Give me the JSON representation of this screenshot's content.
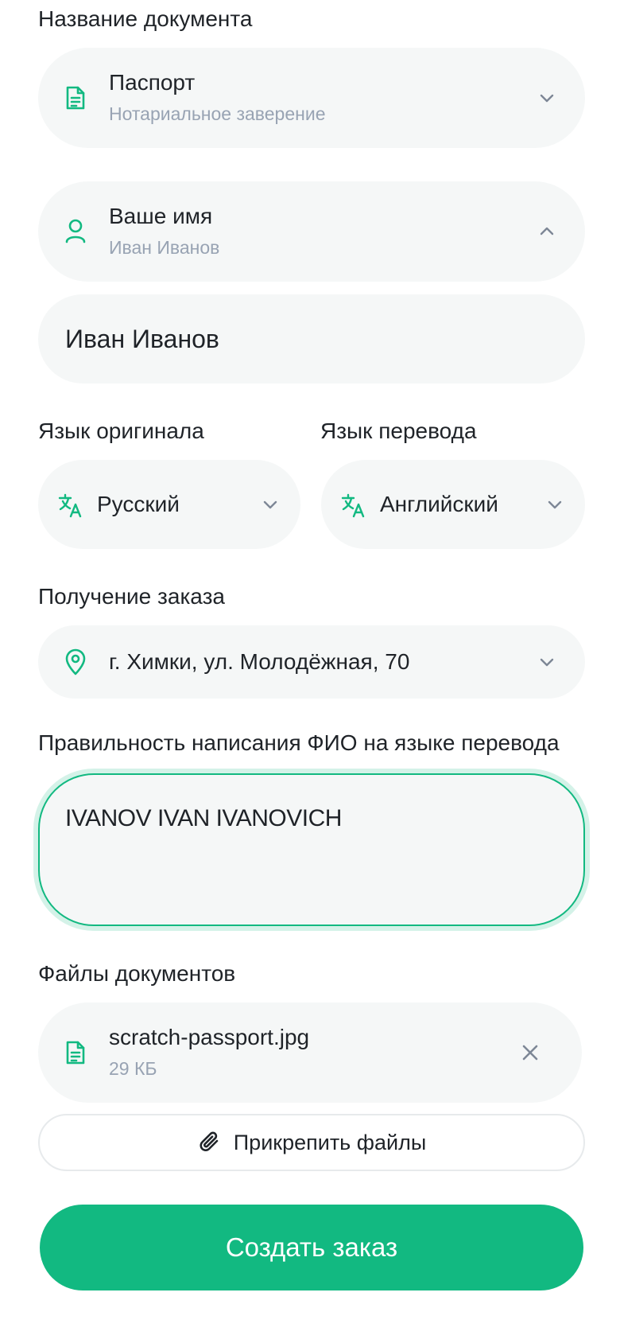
{
  "colors": {
    "accent": "#12b981",
    "field_bg": "#f5f7f7",
    "subtitle": "#98a3b3",
    "chevron": "#7d8796",
    "text": "#1f2328"
  },
  "document": {
    "label": "Название документа",
    "title": "Паспорт",
    "subtitle": "Нотариальное заверение",
    "icon": "document-icon"
  },
  "name": {
    "title": "Ваше имя",
    "subtitle": "Иван Иванов",
    "icon": "user-icon",
    "input_value": "Иван Иванов"
  },
  "languages": {
    "source_label": "Язык оригинала",
    "source_value": "Русский",
    "target_label": "Язык перевода",
    "target_value": "Английский",
    "icon": "translate-icon"
  },
  "pickup": {
    "label": "Получение заказа",
    "value": "г. Химки, ул. Молодёжная, 70",
    "icon": "location-pin-icon"
  },
  "spelling": {
    "label": "Правильность написания ФИО на языке перевода",
    "value": "IVANOV IVAN IVANOVICH"
  },
  "files": {
    "label": "Файлы документов",
    "items": [
      {
        "name": "scratch-passport.jpg",
        "size": "29 КБ",
        "icon": "document-icon"
      }
    ],
    "attach_label": "Прикрепить файлы",
    "attach_icon": "paperclip-icon"
  },
  "submit": {
    "label": "Создать заказ"
  }
}
